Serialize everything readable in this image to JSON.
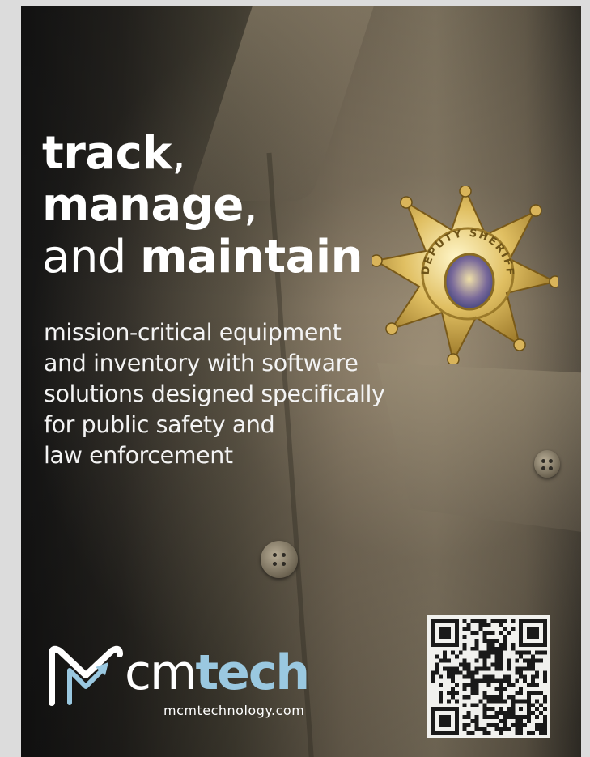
{
  "headline": {
    "line1_bold": "track",
    "line1_punct": ",",
    "line2_bold": "manage",
    "line2_punct": ",",
    "line3_light": "and ",
    "line3_bold": "maintain"
  },
  "body_lines": [
    "mission-critical equipment",
    "and inventory with software",
    "solutions designed specifically",
    "for public safety and",
    "law enforcement"
  ],
  "badge": {
    "text": "DEPUTY SHERIFF"
  },
  "logo": {
    "word_part1": "cmtech",
    "word_part1_plain": "cm",
    "word_part2": "tech",
    "url": "mcmtechnology.com",
    "accent_color": "#9ac8e0"
  },
  "qr": {
    "icon": "qr-code-icon"
  }
}
